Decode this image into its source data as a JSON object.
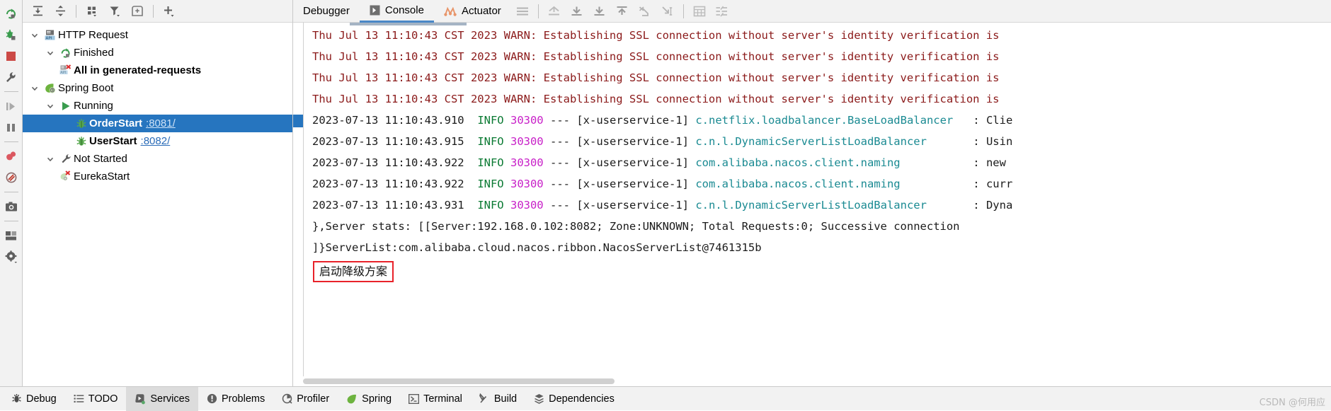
{
  "left_toolbar": {
    "buttons": [
      {
        "name": "rerun-icon",
        "title": "Rerun"
      },
      {
        "name": "rerun-debug-icon",
        "title": "Rerun Debug"
      },
      {
        "name": "stop-icon",
        "title": "Stop"
      },
      {
        "name": "wrench-settings-icon",
        "title": "Settings"
      },
      {
        "name": "resume-program-icon",
        "title": "Resume Program"
      },
      {
        "name": "pause-program-icon",
        "title": "Pause Program"
      },
      {
        "name": "view-breakpoints-icon",
        "title": "View Breakpoints"
      },
      {
        "name": "mute-breakpoints-icon",
        "title": "Mute Breakpoints"
      },
      {
        "name": "camera-snapshot-icon",
        "title": "Get Thread Dump"
      },
      {
        "name": "layout-icon",
        "title": "Layout"
      },
      {
        "name": "settings-gear-icon",
        "title": "Settings"
      }
    ]
  },
  "tree_toolbar": {
    "buttons": [
      {
        "name": "expand-all-icon",
        "title": "Expand All"
      },
      {
        "name": "collapse-all-icon",
        "title": "Collapse All"
      },
      {
        "name": "group-by-icon",
        "title": "Group By"
      },
      {
        "name": "filter-icon",
        "title": "Filter"
      },
      {
        "name": "add-tab-icon",
        "title": "Add Tab"
      },
      {
        "name": "add-service-icon",
        "title": "Add Service"
      }
    ]
  },
  "services_tree": {
    "nodes": [
      {
        "id": "http-request",
        "label": "HTTP Request",
        "indent": 1,
        "arrow": "down",
        "icon": "api-icon",
        "bold": false,
        "selected": false,
        "port": ""
      },
      {
        "id": "finished",
        "label": "Finished",
        "indent": 2,
        "arrow": "down",
        "icon": "rerun-green-icon",
        "bold": false,
        "selected": false,
        "port": ""
      },
      {
        "id": "all-in-generated",
        "label": "All in generated-requests",
        "indent": 3,
        "arrow": "none",
        "icon": "api-error-icon",
        "bold": true,
        "selected": false,
        "port": ""
      },
      {
        "id": "spring-boot",
        "label": "Spring Boot",
        "indent": 1,
        "arrow": "down",
        "icon": "spring-leaf-icon",
        "bold": false,
        "selected": false,
        "port": ""
      },
      {
        "id": "running",
        "label": "Running",
        "indent": 2,
        "arrow": "down",
        "icon": "run-green-icon",
        "bold": false,
        "selected": false,
        "port": ""
      },
      {
        "id": "order-start",
        "label": "OrderStart",
        "indent": 3,
        "arrow": "none",
        "icon": "bug-green-icon",
        "bold": true,
        "selected": true,
        "port": ":8081/"
      },
      {
        "id": "user-start",
        "label": "UserStart",
        "indent": 3,
        "arrow": "none",
        "icon": "bug-green-icon",
        "bold": true,
        "selected": false,
        "port": ":8082/"
      },
      {
        "id": "not-started",
        "label": "Not Started",
        "indent": 2,
        "arrow": "down",
        "icon": "wrench-icon",
        "bold": false,
        "selected": false,
        "port": ""
      },
      {
        "id": "eureka-start",
        "label": "EurekaStart",
        "indent": 3,
        "arrow": "none",
        "icon": "spring-error-icon",
        "bold": false,
        "selected": false,
        "port": ""
      }
    ]
  },
  "console": {
    "tabs": [
      {
        "id": "debugger",
        "label": "Debugger",
        "icon": "",
        "active": false
      },
      {
        "id": "console",
        "label": "Console",
        "icon": "console-icon",
        "active": true
      },
      {
        "id": "actuator",
        "label": "Actuator",
        "icon": "actuator-icon",
        "active": false
      }
    ],
    "toolbar": [
      {
        "name": "soft-wrap-icon",
        "title": "Soft-Wrap"
      },
      {
        "name": "scroll-to-top-icon",
        "title": "Scroll to Top"
      },
      {
        "name": "scroll-to-end-icon",
        "title": "Scroll to End"
      },
      {
        "name": "print-icon",
        "title": "Print"
      },
      {
        "name": "up-the-stack-icon",
        "title": "Up the Stack Trace"
      },
      {
        "name": "clear-all-icon",
        "title": "Clear All"
      },
      {
        "name": "down-the-stack-icon",
        "title": "Down the Stack Trace"
      },
      {
        "name": "table-view-icon",
        "title": "Table View"
      },
      {
        "name": "align-lines-icon",
        "title": "Align Lines"
      }
    ],
    "lines": [
      {
        "type": "warn",
        "text": "Thu Jul 13 11:10:43 CST 2023 WARN: Establishing SSL connection without server's identity verification is"
      },
      {
        "type": "warn",
        "text": "Thu Jul 13 11:10:43 CST 2023 WARN: Establishing SSL connection without server's identity verification is"
      },
      {
        "type": "warn",
        "text": "Thu Jul 13 11:10:43 CST 2023 WARN: Establishing SSL connection without server's identity verification is"
      },
      {
        "type": "warn",
        "text": "Thu Jul 13 11:10:43 CST 2023 WARN: Establishing SSL connection without server's identity verification is"
      },
      {
        "type": "info",
        "time": "2023-07-13 11:10:43.910",
        "level": "INFO",
        "pid": "30300",
        "dash": "---",
        "thread": "[x-userservice-1]",
        "logger": "c.netflix.loadbalancer.BaseLoadBalancer",
        "sep": ": ",
        "message": "Clie"
      },
      {
        "type": "info",
        "time": "2023-07-13 11:10:43.915",
        "level": "INFO",
        "pid": "30300",
        "dash": "---",
        "thread": "[x-userservice-1]",
        "logger": "c.n.l.DynamicServerListLoadBalancer",
        "sep": ": ",
        "message": "Usin"
      },
      {
        "type": "info",
        "time": "2023-07-13 11:10:43.922",
        "level": "INFO",
        "pid": "30300",
        "dash": "---",
        "thread": "[x-userservice-1]",
        "logger": "com.alibaba.nacos.client.naming",
        "sep": ": ",
        "message": "new"
      },
      {
        "type": "info",
        "time": "2023-07-13 11:10:43.922",
        "level": "INFO",
        "pid": "30300",
        "dash": "---",
        "thread": "[x-userservice-1]",
        "logger": "com.alibaba.nacos.client.naming",
        "sep": ": ",
        "message": "curr"
      },
      {
        "type": "info",
        "time": "2023-07-13 11:10:43.931",
        "level": "INFO",
        "pid": "30300",
        "dash": "---",
        "thread": "[x-userservice-1]",
        "logger": "c.n.l.DynamicServerListLoadBalancer",
        "sep": ": ",
        "message": "Dyna"
      },
      {
        "type": "plain",
        "text": "},Server stats: [[Server:192.168.0.102:8082;    Zone:UNKNOWN;   Total Requests:0;   Successive connection"
      },
      {
        "type": "plain",
        "text": "]}ServerList:com.alibaba.cloud.nacos.ribbon.NacosServerList@7461315b"
      }
    ],
    "annotation": {
      "text": "启动降级方案",
      "border_color": "#e8222a"
    }
  },
  "status_bar": {
    "items": [
      {
        "id": "debug",
        "label": "Debug",
        "icon": "bug-icon",
        "active": false
      },
      {
        "id": "todo",
        "label": "TODO",
        "icon": "todo-list-icon",
        "active": false
      },
      {
        "id": "services",
        "label": "Services",
        "icon": "services-icon",
        "active": true
      },
      {
        "id": "problems",
        "label": "Problems",
        "icon": "problems-icon",
        "active": false
      },
      {
        "id": "profiler",
        "label": "Profiler",
        "icon": "profiler-icon",
        "active": false
      },
      {
        "id": "spring",
        "label": "Spring",
        "icon": "spring-leaf-icon",
        "active": false
      },
      {
        "id": "terminal",
        "label": "Terminal",
        "icon": "terminal-icon",
        "active": false
      },
      {
        "id": "build",
        "label": "Build",
        "icon": "build-hammer-icon",
        "active": false
      },
      {
        "id": "dependencies",
        "label": "Dependencies",
        "icon": "dependencies-icon",
        "active": false
      }
    ],
    "watermark": "CSDN @何用应"
  },
  "colors": {
    "selection": "#2675bf",
    "warn": "#8b1a1a",
    "info": "#0b7a33",
    "pid": "#c820c8",
    "logger": "#1a8a92",
    "link": "#2b6cb8",
    "annotation": "#e8222a"
  }
}
